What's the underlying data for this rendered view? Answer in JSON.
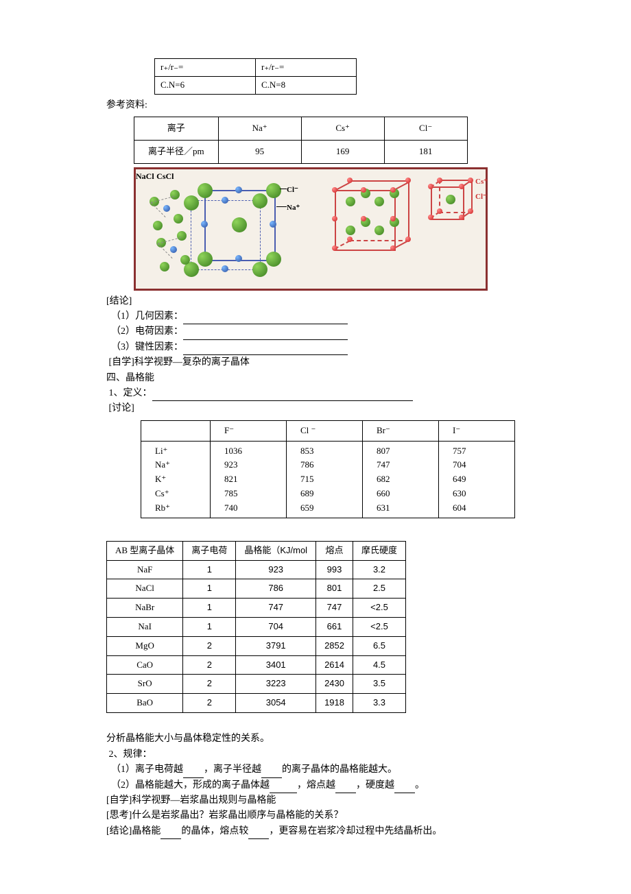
{
  "t1": {
    "r1c1": "r₊/r₋=",
    "r1c2": "r₊/r₋=",
    "r2c1": "C.N=6",
    "r2c2": "C.N=8"
  },
  "ref_label": "参考资料:",
  "t2": {
    "h_ion": "离子",
    "h_rad": "离子半径／pm",
    "na": "Na⁺",
    "cs": "Cs⁺",
    "cl": "Cl⁻",
    "v_na": "95",
    "v_cs": "169",
    "v_cl": "181"
  },
  "diag": {
    "cl": "Cl⁻",
    "na": "Na⁺",
    "cs": "Cs⁺",
    "nacl": "NaCl",
    "cscl": "CsCl"
  },
  "conclusion": {
    "title": "[结论]",
    "l1": "（1）几何因素：",
    "l2": "（2）电荷因素：",
    "l3": "（3）键性因素："
  },
  "self1": "[自学]科学视野—复杂的离子晶体",
  "sec4": "四、晶格能",
  "def": "1、定义：",
  "discuss": "[讨论]",
  "t3": {
    "h_f": "F⁻",
    "h_cl": "Cl ⁻",
    "h_br": "Br⁻",
    "h_i": "I⁻",
    "r1": "Li⁺",
    "r2": "Na⁺",
    "r3": "K⁺",
    "r4": "Cs⁺",
    "r5": "Rb⁺",
    "d": [
      [
        "1036",
        "853",
        "807",
        "757"
      ],
      [
        "923",
        "786",
        "747",
        "704"
      ],
      [
        "821",
        "715",
        "682",
        "649"
      ],
      [
        "785",
        "689",
        "660",
        "630"
      ],
      [
        "740",
        "659",
        "631",
        "604"
      ]
    ]
  },
  "t4": {
    "h1": "AB 型离子晶体",
    "h2": "离子电荷",
    "h3": "晶格能（KJ/mol",
    "h4": "熔点",
    "h5": "摩氏硬度",
    "rows": [
      [
        "NaF",
        "1",
        "923",
        "993",
        "3.2"
      ],
      [
        "NaCl",
        "1",
        "786",
        "801",
        "2.5"
      ],
      [
        "NaBr",
        "1",
        "747",
        "747",
        "<2.5"
      ],
      [
        "NaI",
        "1",
        "704",
        "661",
        "<2.5"
      ],
      [
        "MgO",
        "2",
        "3791",
        "2852",
        "6.5"
      ],
      [
        "CaO",
        "2",
        "3401",
        "2614",
        "4.5"
      ],
      [
        "SrO",
        "2",
        "3223",
        "2430",
        "3.5"
      ],
      [
        "BaO",
        "2",
        "3054",
        "1918",
        "3.3"
      ]
    ]
  },
  "analysis": "分析晶格能大小与晶体稳定性的关系。",
  "rules": {
    "title": "2、规律：",
    "l1a": "（1）离子电荷越",
    "l1b": "，离子半径越",
    "l1c": "的离子晶体的晶格能越大。",
    "l2a": "（2）晶格能越大，形成的离子晶体越",
    "l2b": "，熔点越",
    "l2c": "，硬度越",
    "l2d": "。"
  },
  "self2": "[自学]科学视野—岩浆晶出规则与晶格能",
  "think": "[思考]什么是岩浆晶出？岩浆晶出顺序与晶格能的关系？",
  "conc2a": "[结论]晶格能",
  "conc2b": "的晶体，熔点较",
  "conc2c": "，更容易在岩浆冷却过程中先结晶析出。"
}
